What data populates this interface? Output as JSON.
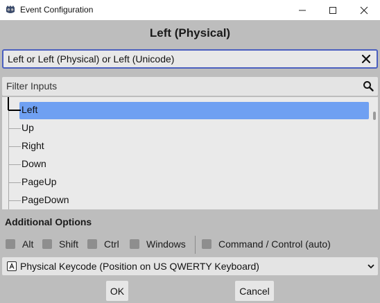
{
  "window": {
    "title": "Event Configuration",
    "icon": "godot-app-icon",
    "controls": [
      "minimize-icon",
      "maximize-icon",
      "close-icon"
    ]
  },
  "header": {
    "event_label": "Left (Physical)"
  },
  "event_field": {
    "value": "Left or Left (Physical) or Left (Unicode)",
    "clear_icon": "close-icon"
  },
  "filter": {
    "placeholder": "Filter Inputs",
    "icon": "search-icon"
  },
  "input_list": {
    "items": [
      {
        "label": "Left",
        "selected": true
      },
      {
        "label": "Up",
        "selected": false
      },
      {
        "label": "Right",
        "selected": false
      },
      {
        "label": "Down",
        "selected": false
      },
      {
        "label": "PageUp",
        "selected": false
      },
      {
        "label": "PageDown",
        "selected": false
      }
    ]
  },
  "additional_options": {
    "title": "Additional Options",
    "modifiers": [
      {
        "label": "Alt",
        "checked": false
      },
      {
        "label": "Shift",
        "checked": false
      },
      {
        "label": "Ctrl",
        "checked": false
      },
      {
        "label": "Windows",
        "checked": false
      },
      {
        "label": "Command / Control (auto)",
        "checked": false
      }
    ]
  },
  "keycode_mode": {
    "selected": "Physical Keycode (Position on US QWERTY Keyboard)",
    "icon": "keyboard-icon"
  },
  "buttons": {
    "ok": "OK",
    "cancel": "Cancel"
  },
  "colors": {
    "selection": "#6fa0f2",
    "focus_border": "#4a5fbf",
    "background": "#bdbdbd"
  }
}
